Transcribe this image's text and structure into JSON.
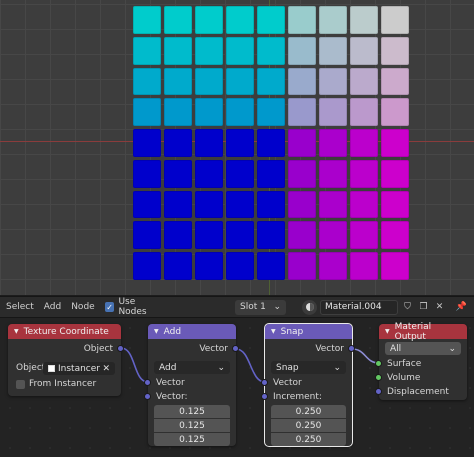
{
  "viewport": {
    "tile_colors": [
      [
        "#00cccc",
        "#00cccc",
        "#00cccc",
        "#00cccc",
        "#00cccc",
        "#99cccc",
        "#aacccc",
        "#bbcccc",
        "#cccccc"
      ],
      [
        "#00bbcc",
        "#00bbcc",
        "#00bbcc",
        "#00bbcc",
        "#00bbcc",
        "#99bbcc",
        "#aabbcc",
        "#bbbbcc",
        "#ccbbcc"
      ],
      [
        "#00aacc",
        "#00aacc",
        "#00aacc",
        "#00aacc",
        "#00aacc",
        "#99aacc",
        "#aaaacc",
        "#bbaacc",
        "#ccaacc"
      ],
      [
        "#0099cc",
        "#0099cc",
        "#0099cc",
        "#0099cc",
        "#0099cc",
        "#9999cc",
        "#aa99cc",
        "#bb99cc",
        "#cc99cc"
      ],
      [
        "#0000cc",
        "#0000cc",
        "#0000cc",
        "#0000cc",
        "#0000cc",
        "#9900cc",
        "#aa00cc",
        "#bb00cc",
        "#cc00cc"
      ],
      [
        "#0000cc",
        "#0000cc",
        "#0000cc",
        "#0000cc",
        "#0000cc",
        "#9900cc",
        "#aa00cc",
        "#bb00cc",
        "#cc00cc"
      ],
      [
        "#0000cc",
        "#0000cc",
        "#0000cc",
        "#0000cc",
        "#0000cc",
        "#9900cc",
        "#aa00cc",
        "#bb00cc",
        "#cc00cc"
      ],
      [
        "#0000cc",
        "#0000cc",
        "#0000cc",
        "#0000cc",
        "#0000cc",
        "#9900cc",
        "#aa00cc",
        "#bb00cc",
        "#cc00cc"
      ],
      [
        "#0000cc",
        "#0000cc",
        "#0000cc",
        "#0000cc",
        "#0000cc",
        "#9900cc",
        "#aa00cc",
        "#bb00cc",
        "#cc00cc"
      ]
    ]
  },
  "header": {
    "menu": [
      "Select",
      "Add",
      "Node"
    ],
    "use_nodes_label": "Use Nodes",
    "use_nodes_checked": true,
    "slot_label": "Slot 1",
    "material_name": "Material.004"
  },
  "nodes": {
    "texcoord": {
      "title": "Texture Coordinate",
      "color": "#a8343e",
      "output_object": "Object",
      "object_label": "Object:",
      "object_value": "Instancer",
      "from_instancer_label": "From Instancer"
    },
    "add": {
      "title": "Add",
      "color": "#6a5ab8",
      "output_vector": "Vector",
      "operation": "Add",
      "input_vector": "Vector",
      "vector_label": "Vector:",
      "values": [
        "0.125",
        "0.125",
        "0.125"
      ]
    },
    "snap": {
      "title": "Snap",
      "color": "#6a5ab8",
      "output_vector": "Vector",
      "operation": "Snap",
      "input_vector": "Vector",
      "increment_label": "Increment:",
      "values": [
        "0.250",
        "0.250",
        "0.250"
      ]
    },
    "output": {
      "title": "Material Output",
      "color": "#a8343e",
      "target": "All",
      "surface": "Surface",
      "volume": "Volume",
      "displacement": "Displacement"
    }
  }
}
